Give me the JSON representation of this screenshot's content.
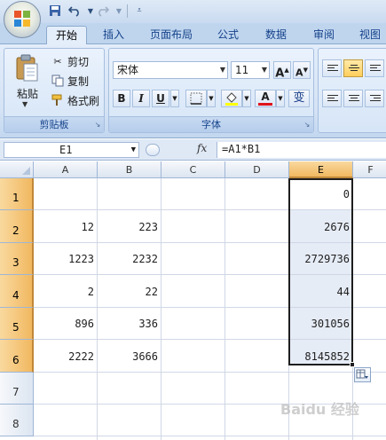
{
  "ribbon": {
    "tabs": [
      "开始",
      "插入",
      "页面布局",
      "公式",
      "数据",
      "审阅",
      "视图"
    ],
    "active_tab": "开始"
  },
  "clipboard": {
    "paste_label": "粘贴",
    "cut_label": "剪切",
    "copy_label": "复制",
    "format_painter_label": "格式刷",
    "group_label": "剪贴板"
  },
  "font": {
    "font_name": "宋体",
    "font_size": "11",
    "grow_label": "A",
    "shrink_label": "A",
    "bold": "B",
    "italic": "I",
    "underline": "U",
    "font_color_glyph": "A",
    "phonetic_glyph": "变",
    "group_label": "字体",
    "font_color": "#e0141b",
    "highlight_color": "#ffff00"
  },
  "formula_bar": {
    "name_box": "E1",
    "fx_label": "fx",
    "formula": "=A1*B1"
  },
  "sheet": {
    "columns": [
      "A",
      "B",
      "C",
      "D",
      "E",
      "F"
    ],
    "selected_column": "E",
    "rows": [
      "1",
      "2",
      "3",
      "4",
      "5",
      "6",
      "7",
      "8"
    ],
    "selected_rows": [
      "1",
      "2",
      "3",
      "4",
      "5",
      "6"
    ],
    "cells": {
      "A2": "12",
      "B2": "223",
      "E1": "0",
      "E2": "2676",
      "A3": "1223",
      "B3": "2232",
      "E3": "2729736",
      "A4": "2",
      "B4": "22",
      "E4": "44",
      "A5": "896",
      "B5": "336",
      "E5": "301056",
      "A6": "2222",
      "B6": "3666",
      "E6": "8145852"
    }
  },
  "watermark": "Baidu 经验"
}
